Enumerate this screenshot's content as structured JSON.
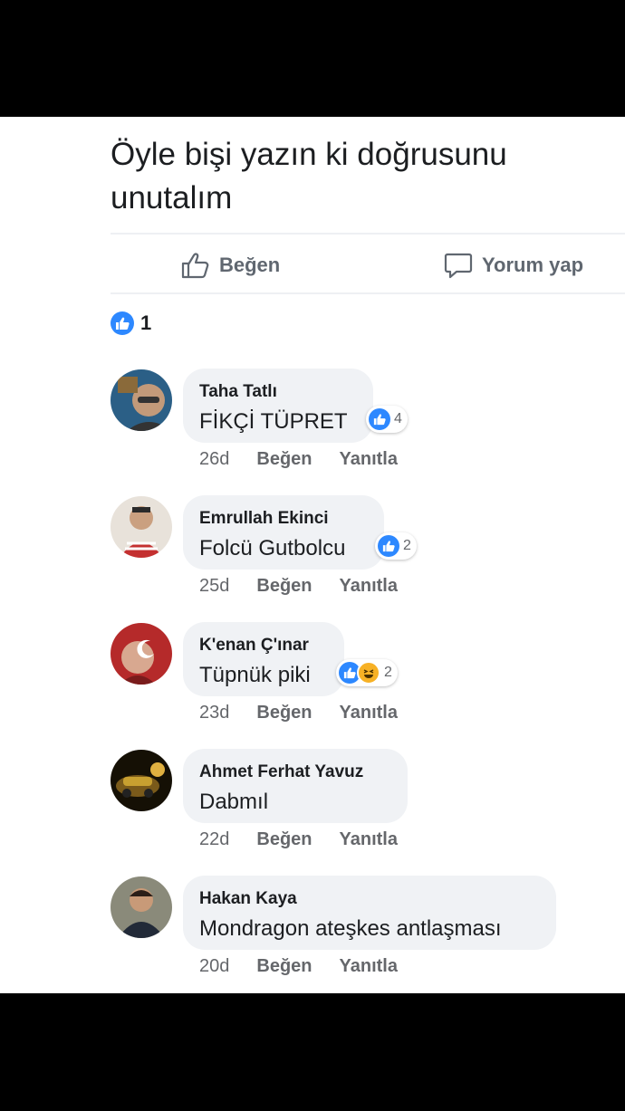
{
  "post": {
    "text": "Öyle bişi yazın ki doğrusunu unutalım",
    "actions": {
      "like_label": "Beğen",
      "comment_label": "Yorum yap"
    },
    "like_count": "1"
  },
  "comments": [
    {
      "name": "Taha Tatlı",
      "text": "FİKÇİ TÜPRET",
      "reactions": [
        "like"
      ],
      "reaction_count": "4",
      "time": "26d",
      "like_label": "Beğen",
      "reply_label": "Yanıtla"
    },
    {
      "name": "Emrullah Ekinci",
      "text": "Folcü Gutbolcu",
      "reactions": [
        "like"
      ],
      "reaction_count": "2",
      "time": "25d",
      "like_label": "Beğen",
      "reply_label": "Yanıtla"
    },
    {
      "name": "K'enan Ç'ınar",
      "text": "Tüpnük piki",
      "reactions": [
        "like",
        "haha"
      ],
      "reaction_count": "2",
      "time": "23d",
      "like_label": "Beğen",
      "reply_label": "Yanıtla"
    },
    {
      "name": "Ahmet Ferhat Yavuz",
      "text": "Dabmıl",
      "reactions": [],
      "reaction_count": "",
      "time": "22d",
      "like_label": "Beğen",
      "reply_label": "Yanıtla"
    },
    {
      "name": "Hakan Kaya",
      "text": "Mondragon ateşkes antlaşması",
      "reactions": [],
      "reaction_count": "",
      "time": "20d",
      "like_label": "Beğen",
      "reply_label": "Yanıtla"
    }
  ],
  "colors": {
    "reaction_blue": "#2d88ff",
    "bubble_gray": "#f0f2f5",
    "meta_gray": "#65676b"
  }
}
